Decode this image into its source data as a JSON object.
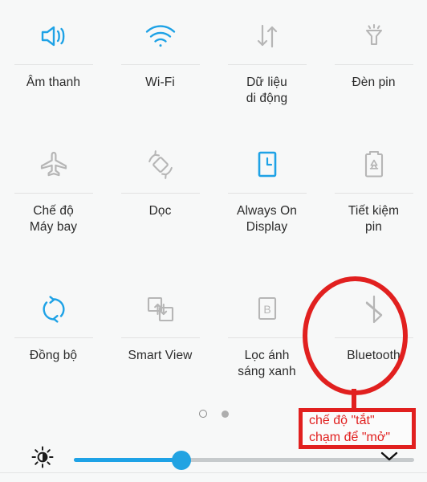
{
  "panel": {
    "title": "Quick settings panel",
    "accent_on_color": "#1ea2e6",
    "accent_off_color": "#b6b6b6",
    "annotation_color": "#e1201f",
    "background_color": "#f7f8f8"
  },
  "tiles": [
    {
      "label": "Âm thanh",
      "icon": "sound-icon",
      "state": "on"
    },
    {
      "label": "Wi-Fi",
      "icon": "wifi-icon",
      "state": "on"
    },
    {
      "label": "Dữ liệu\ndi động",
      "icon": "mobile-data-icon",
      "state": "off"
    },
    {
      "label": "Đèn pin",
      "icon": "flashlight-icon",
      "state": "off"
    },
    {
      "label": "Chế độ\nMáy bay",
      "icon": "airplane-mode-icon",
      "state": "off"
    },
    {
      "label": "Dọc",
      "icon": "auto-rotate-icon",
      "state": "off"
    },
    {
      "label": "Always On\nDisplay",
      "icon": "always-on-display-icon",
      "state": "on"
    },
    {
      "label": "Tiết kiệm\npin",
      "icon": "battery-saver-icon",
      "state": "off"
    },
    {
      "label": "Đồng bộ",
      "icon": "sync-icon",
      "state": "on"
    },
    {
      "label": "Smart View",
      "icon": "smart-view-icon",
      "state": "off"
    },
    {
      "label": "Lọc ánh\nsáng xanh",
      "icon": "blue-light-filter-icon",
      "state": "off"
    },
    {
      "label": "Bluetooth",
      "icon": "bluetooth-icon",
      "state": "off"
    }
  ],
  "pager": {
    "dots": [
      {
        "name": "page-dot-1",
        "state": "hollow"
      },
      {
        "name": "page-dot-2",
        "state": "filled"
      }
    ]
  },
  "brightness": {
    "icon": "brightness-icon",
    "value_percent": 33,
    "fill_color": "#1ea2e6",
    "track_color": "#c6cacc"
  },
  "collapse": {
    "icon": "chevron-down-icon"
  },
  "annotation": {
    "target_tile": "Bluetooth",
    "callout_line_1": "chế độ \"tắt\"",
    "callout_line_2": "chạm để \"mở\""
  }
}
